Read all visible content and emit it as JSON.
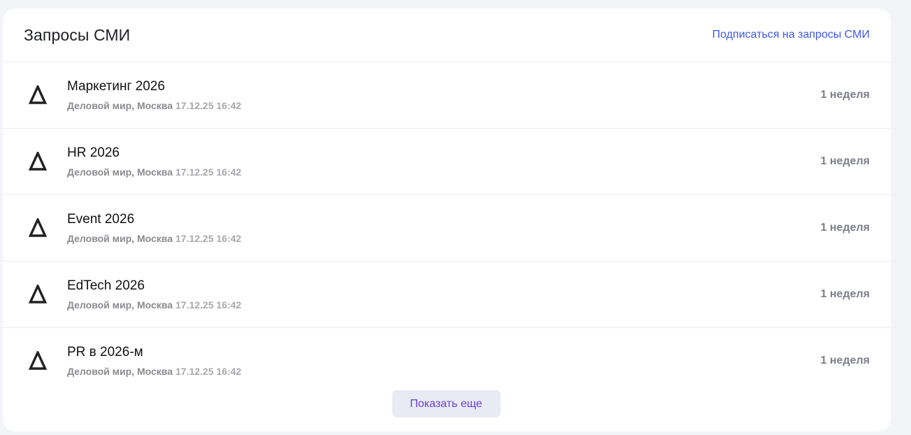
{
  "header": {
    "title": "Запросы СМИ",
    "subscribe_link": "Подписаться на запросы СМИ"
  },
  "items": [
    {
      "title": "Маркетинг 2026",
      "source": "Деловой мир, Москва",
      "date": "17.12.25 16:42",
      "period": "1 неделя",
      "icon": "delta-logo-icon"
    },
    {
      "title": "HR 2026",
      "source": "Деловой мир, Москва",
      "date": "17.12.25 16:42",
      "period": "1 неделя",
      "icon": "delta-logo-icon"
    },
    {
      "title": "Event 2026",
      "source": "Деловой мир, Москва",
      "date": "17.12.25 16:42",
      "period": "1 неделя",
      "icon": "delta-logo-icon"
    },
    {
      "title": "EdTech 2026",
      "source": "Деловой мир, Москва",
      "date": "17.12.25 16:42",
      "period": "1 неделя",
      "icon": "delta-logo-icon"
    },
    {
      "title": "PR в 2026-м",
      "source": "Деловой мир, Москва",
      "date": "17.12.25 16:42",
      "period": "1 неделя",
      "icon": "delta-logo-icon"
    }
  ],
  "footer": {
    "show_more_label": "Показать еще"
  },
  "colors": {
    "accent_link": "#3e56e8",
    "button_text": "#6a3fd6",
    "button_bg": "#e8ebf3"
  }
}
